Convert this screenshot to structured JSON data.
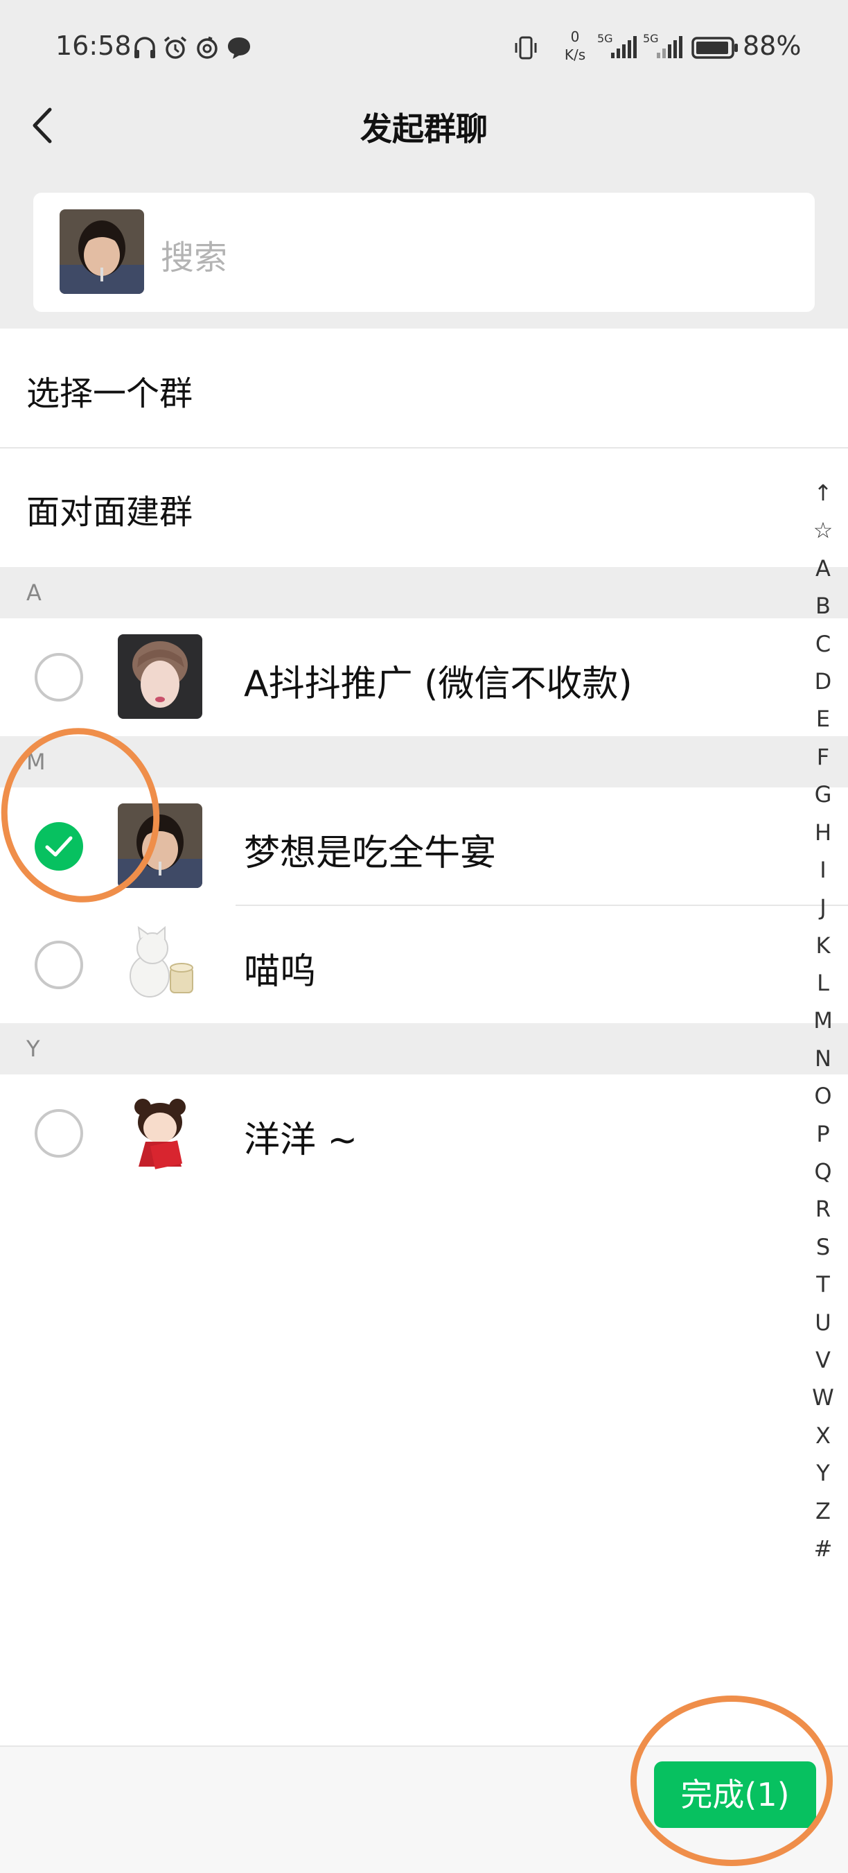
{
  "status_bar": {
    "time": "16:58",
    "net_speed_value": "0",
    "net_speed_unit": "K/s",
    "signal_1": "5G",
    "signal_2": "5G",
    "battery": "88%"
  },
  "nav": {
    "title": "发起群聊",
    "back_icon": "chevron-left-icon"
  },
  "search": {
    "placeholder": "搜索"
  },
  "menu": [
    {
      "label": "选择一个群"
    },
    {
      "label": "面对面建群"
    }
  ],
  "sections": [
    {
      "letter": "A",
      "contacts": [
        {
          "name": "A抖抖推广 (微信不收款)",
          "selected": false
        }
      ]
    },
    {
      "letter": "M",
      "contacts": [
        {
          "name": "梦想是吃全牛宴",
          "selected": true
        },
        {
          "name": "喵呜",
          "selected": false
        }
      ]
    },
    {
      "letter": "Y",
      "contacts": [
        {
          "name": "洋洋 ~",
          "selected": false
        }
      ]
    }
  ],
  "index_bar": [
    "↑",
    "☆",
    "A",
    "B",
    "C",
    "D",
    "E",
    "F",
    "G",
    "H",
    "I",
    "J",
    "K",
    "L",
    "M",
    "N",
    "O",
    "P",
    "Q",
    "R",
    "S",
    "T",
    "U",
    "V",
    "W",
    "X",
    "Y",
    "Z",
    "#"
  ],
  "footer": {
    "done_label": "完成(1)"
  },
  "colors": {
    "accent_green": "#07c160",
    "annotation_orange": "#ef8e4a",
    "background_gray": "#ededed"
  }
}
